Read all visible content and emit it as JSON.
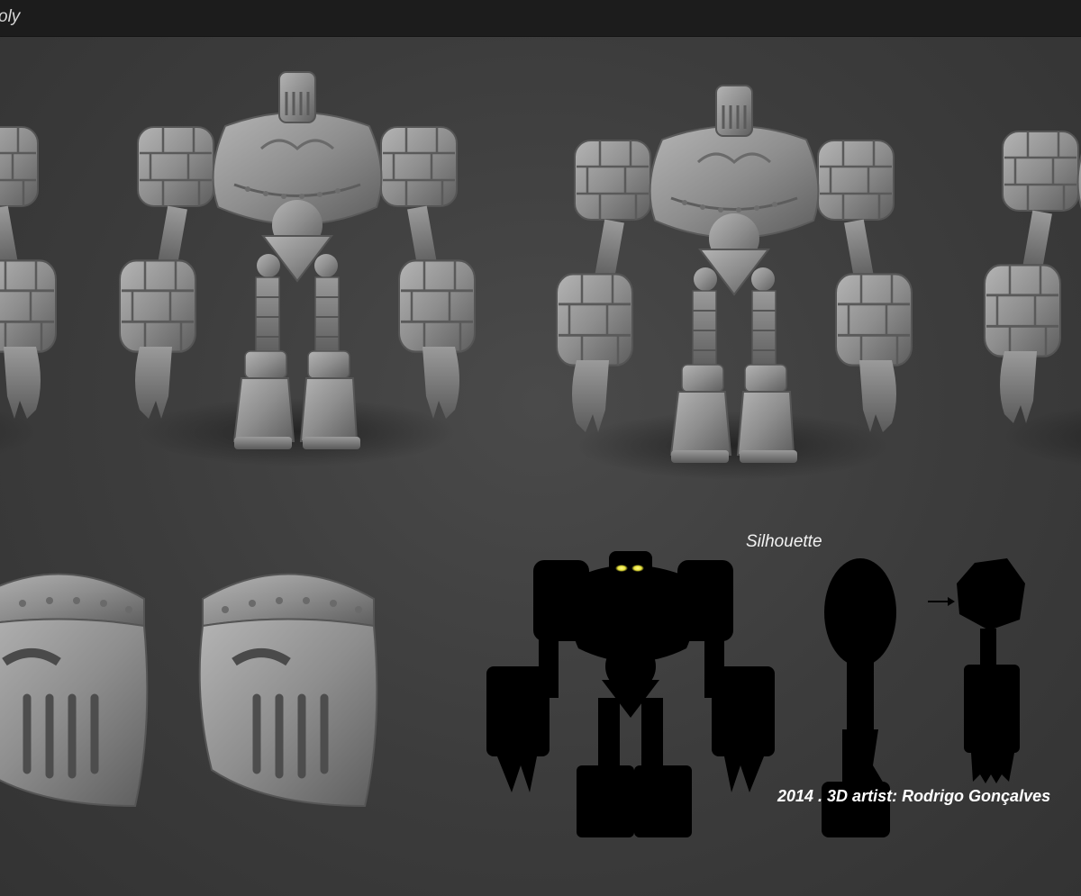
{
  "header": {
    "title": "oly"
  },
  "labels": {
    "silhouette": "Silhouette",
    "credit": "2014 . 3D artist: Rodrigo Gonçalves"
  },
  "colors": {
    "background": "#3f3f3f",
    "topbar": "#1c1c1c",
    "clay": "#8c8c8c",
    "silhouette": "#000000",
    "eyes": "#f2ee40"
  },
  "icons": {
    "arrow": "right-arrow-icon"
  }
}
